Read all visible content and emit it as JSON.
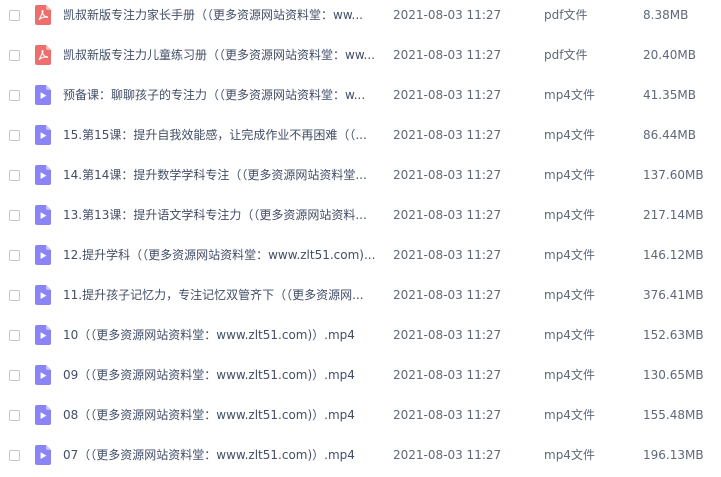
{
  "colors": {
    "pdf_icon": "#ee6e6e",
    "video_icon": "#8b84f7",
    "text": "#424e67",
    "meta": "#5f6778"
  },
  "files": [
    {
      "name": "凯叔新版专注力家长手册（（更多资源网站资料堂：ww...",
      "date": "2021-08-03 11:27",
      "type": "pdf文件",
      "size": "8.38MB",
      "icon": "pdf-icon"
    },
    {
      "name": "凯叔新版专注力儿童练习册（（更多资源网站资料堂：ww...",
      "date": "2021-08-03 11:27",
      "type": "pdf文件",
      "size": "20.40MB",
      "icon": "pdf-icon"
    },
    {
      "name": "预备课：聊聊孩子的专注力（（更多资源网站资料堂：w...",
      "date": "2021-08-03 11:27",
      "type": "mp4文件",
      "size": "41.35MB",
      "icon": "video-icon"
    },
    {
      "name": "15.第15课：提升自我效能感，让完成作业不再困难（（...",
      "date": "2021-08-03 11:27",
      "type": "mp4文件",
      "size": "86.44MB",
      "icon": "video-icon"
    },
    {
      "name": "14.第14课：提升数学学科专注（（更多资源网站资料堂...",
      "date": "2021-08-03 11:27",
      "type": "mp4文件",
      "size": "137.60MB",
      "icon": "video-icon"
    },
    {
      "name": "13.第13课：提升语文学科专注力（（更多资源网站资料...",
      "date": "2021-08-03 11:27",
      "type": "mp4文件",
      "size": "217.14MB",
      "icon": "video-icon"
    },
    {
      "name": "12.提升学科（（更多资源网站资料堂：www.zlt51.com)...",
      "date": "2021-08-03 11:27",
      "type": "mp4文件",
      "size": "146.12MB",
      "icon": "video-icon"
    },
    {
      "name": "11.提升孩子记忆力，专注记忆双管齐下（（更多资源网...",
      "date": "2021-08-03 11:27",
      "type": "mp4文件",
      "size": "376.41MB",
      "icon": "video-icon"
    },
    {
      "name": "10（（更多资源网站资料堂：www.zlt51.com)）.mp4",
      "date": "2021-08-03 11:27",
      "type": "mp4文件",
      "size": "152.63MB",
      "icon": "video-icon"
    },
    {
      "name": "09（（更多资源网站资料堂：www.zlt51.com)）.mp4",
      "date": "2021-08-03 11:27",
      "type": "mp4文件",
      "size": "130.65MB",
      "icon": "video-icon"
    },
    {
      "name": "08（（更多资源网站资料堂：www.zlt51.com)）.mp4",
      "date": "2021-08-03 11:27",
      "type": "mp4文件",
      "size": "155.48MB",
      "icon": "video-icon"
    },
    {
      "name": "07（（更多资源网站资料堂：www.zlt51.com)）.mp4",
      "date": "2021-08-03 11:27",
      "type": "mp4文件",
      "size": "196.13MB",
      "icon": "video-icon"
    }
  ]
}
